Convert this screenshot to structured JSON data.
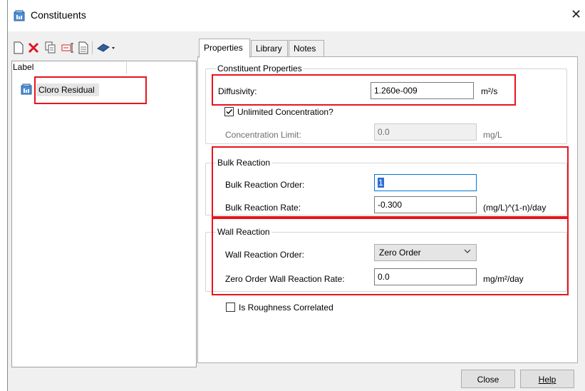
{
  "window": {
    "title": "Constituents",
    "close_glyph": "✕"
  },
  "toolbar": {
    "icons": [
      "new-icon",
      "delete-icon",
      "copy-icon",
      "rename-icon",
      "report-icon",
      "library-icon"
    ]
  },
  "list": {
    "header": "Label",
    "items": [
      {
        "label": "Cloro Residual",
        "icon": "constituent-icon"
      }
    ]
  },
  "tabs": [
    {
      "label": "Properties",
      "active": true
    },
    {
      "label": "Library",
      "active": false
    },
    {
      "label": "Notes",
      "active": false
    }
  ],
  "constituent_properties": {
    "title": "Constituent Properties",
    "diffusivity_label": "Diffusivity:",
    "diffusivity_value": "1.260e-009",
    "diffusivity_unit": "m²/s",
    "unlimited_label": "Unlimited Concentration?",
    "unlimited_checked": true,
    "limit_label": "Concentration Limit:",
    "limit_value": "0.0",
    "limit_unit": "mg/L"
  },
  "bulk_reaction": {
    "title": "Bulk Reaction",
    "order_label": "Bulk Reaction Order:",
    "order_value": "1",
    "rate_label": "Bulk Reaction Rate:",
    "rate_value": "-0.300",
    "rate_unit": "(mg/L)^(1-n)/day"
  },
  "wall_reaction": {
    "title": "Wall Reaction",
    "order_label": "Wall Reaction Order:",
    "order_value": "Zero Order",
    "rate_label": "Zero Order Wall Reaction Rate:",
    "rate_value": "0.0",
    "rate_unit": "mg/m²/day"
  },
  "roughness": {
    "label": "Is Roughness Correlated",
    "checked": false
  },
  "buttons": {
    "close": "Close",
    "help": "Help"
  },
  "colors": {
    "highlight_box": "#e8141c",
    "focus_border": "#0078d7"
  }
}
